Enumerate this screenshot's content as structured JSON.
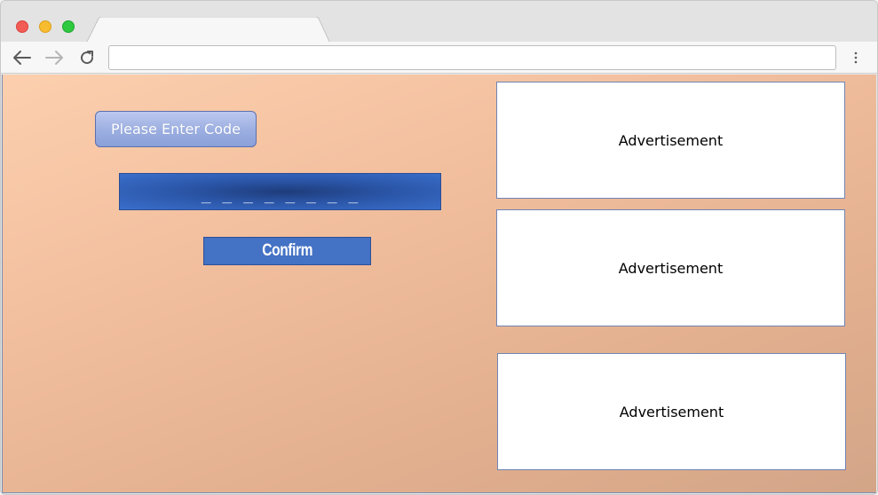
{
  "browser": {
    "tab_title": "",
    "address_value": "",
    "icons": {
      "close": "close-icon",
      "minimize": "minimize-icon",
      "maximize": "maximize-icon",
      "back": "arrow-left-icon",
      "forward": "arrow-right-icon",
      "reload": "reload-icon",
      "menu": "kebab-menu-icon"
    },
    "colors": {
      "close": "#f25c55",
      "minimize": "#f7bc2f",
      "maximize": "#2fc940"
    }
  },
  "page": {
    "code_label": "Please Enter Code",
    "code_input_value": "_ _ _ _ _ _ _ _",
    "confirm_label": "Confirm",
    "ads": [
      {
        "label": "Advertisement"
      },
      {
        "label": "Advertisement"
      },
      {
        "label": "Advertisement"
      }
    ],
    "colors": {
      "button_blue": "#4472c4",
      "input_blue": "#2b56a8",
      "background_peach": "#f2bf9e"
    }
  }
}
